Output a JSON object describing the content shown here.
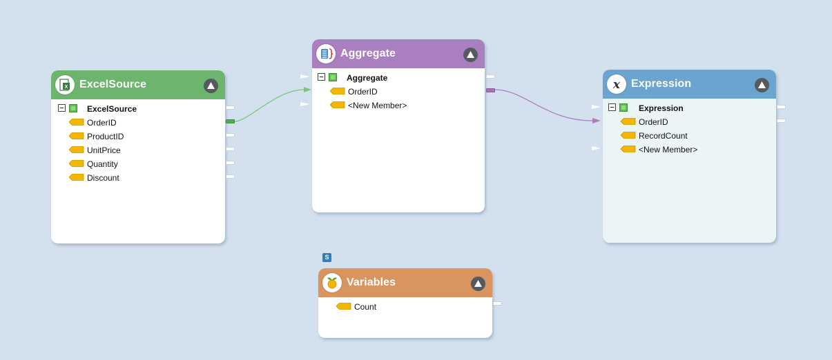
{
  "colors": {
    "canvas_bg": "#d3e1ef",
    "excel_header": "#6db56d",
    "aggregate_header": "#a97fbf",
    "expression_header": "#6ba4cf",
    "variables_header": "#d9955f",
    "expression_body": "#ecf5f5",
    "link_green": "#7bc47b",
    "link_purple": "#a97fbf"
  },
  "nodes": {
    "excel": {
      "title": "ExcelSource",
      "icon": "excel-icon",
      "root": "ExcelSource",
      "fields": [
        "OrderID",
        "ProductID",
        "UnitPrice",
        "Quantity",
        "Discount"
      ]
    },
    "aggregate": {
      "title": "Aggregate",
      "icon": "aggregate-icon",
      "root": "Aggregate",
      "fields": [
        "OrderID",
        "<New Member>"
      ]
    },
    "expression": {
      "title": "Expression",
      "icon": "expression-icon",
      "root": "Expression",
      "fields": [
        "OrderID",
        "RecordCount",
        "<New Member>"
      ]
    },
    "variables": {
      "title": "Variables",
      "icon": "variables-icon",
      "badge": "S",
      "fields": [
        "Count"
      ]
    }
  }
}
